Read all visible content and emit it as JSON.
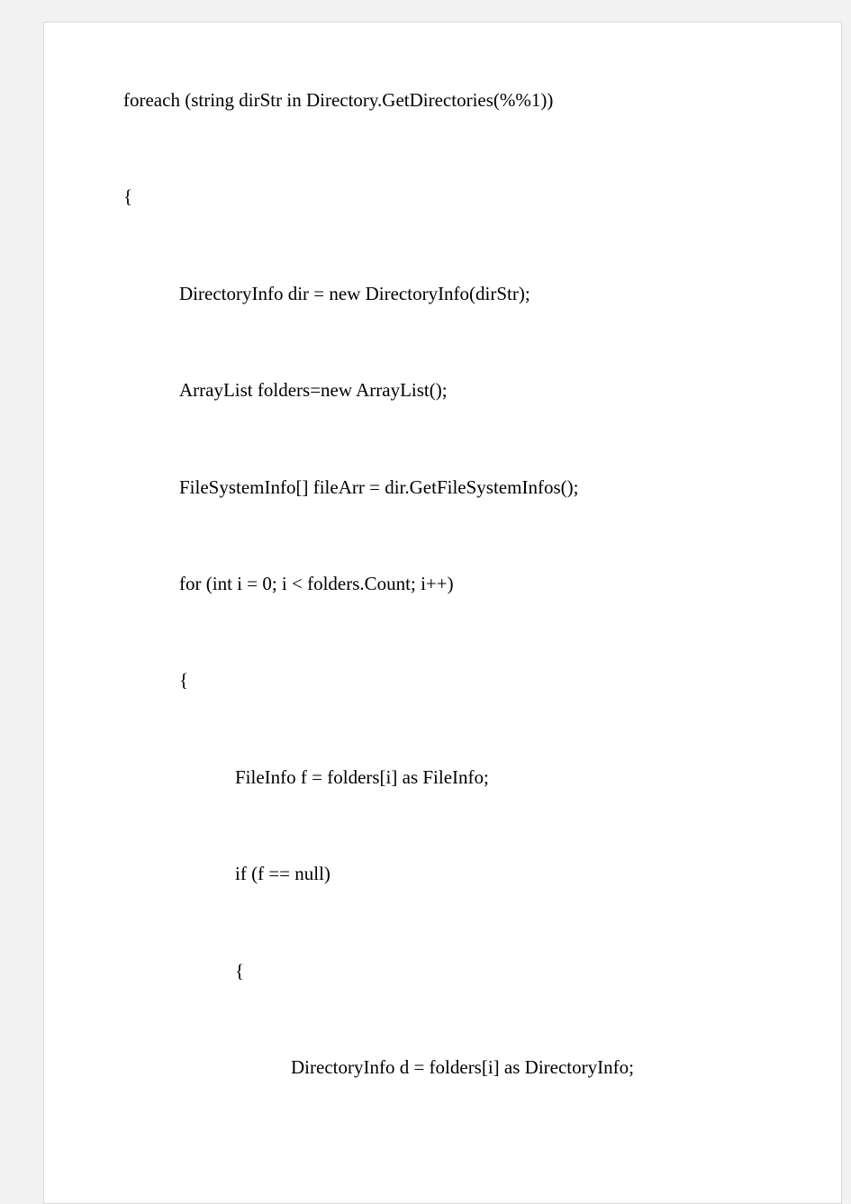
{
  "code": {
    "lines": [
      {
        "indent": 0,
        "text": "foreach (string dirStr in Directory.GetDirectories(%%1))"
      },
      {
        "indent": 0,
        "text": "{"
      },
      {
        "indent": 1,
        "text": "DirectoryInfo dir = new DirectoryInfo(dirStr);"
      },
      {
        "indent": 1,
        "text": "ArrayList folders=new ArrayList();"
      },
      {
        "indent": 1,
        "text": "FileSystemInfo[] fileArr = dir.GetFileSystemInfos();"
      },
      {
        "indent": 1,
        "text": "for (int i = 0; i < folders.Count; i++)"
      },
      {
        "indent": 1,
        "text": "{"
      },
      {
        "indent": 2,
        "text": "FileInfo f = folders[i] as FileInfo;"
      },
      {
        "indent": 2,
        "text": "if (f == null)"
      },
      {
        "indent": 2,
        "text": "{"
      },
      {
        "indent": 3,
        "text": "DirectoryInfo d = folders[i] as DirectoryInfo;"
      }
    ]
  }
}
